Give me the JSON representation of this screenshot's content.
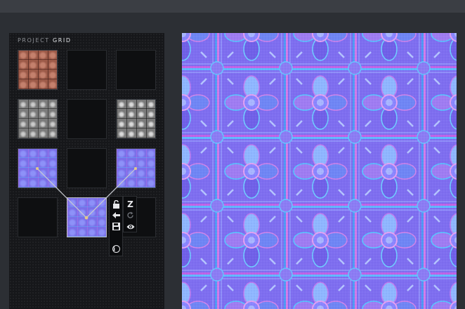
{
  "panel": {
    "title_prefix": "PROJECT",
    "title_highlight": "GRID"
  },
  "grid": {
    "cells": [
      {
        "name": "grid-cell-r1c1",
        "texture": "diffuse",
        "state": "filled"
      },
      {
        "name": "grid-cell-r1c2",
        "texture": "empty",
        "state": "empty"
      },
      {
        "name": "grid-cell-r1c3",
        "texture": "empty",
        "state": "empty"
      },
      {
        "name": "grid-cell-r2c1",
        "texture": "height-map",
        "state": "filled"
      },
      {
        "name": "grid-cell-r2c2",
        "texture": "empty",
        "state": "empty"
      },
      {
        "name": "grid-cell-r2c3",
        "texture": "specular-map",
        "state": "filled"
      },
      {
        "name": "grid-cell-r3c1",
        "texture": "normal-map",
        "state": "filled"
      },
      {
        "name": "grid-cell-r3c2",
        "texture": "empty",
        "state": "empty"
      },
      {
        "name": "grid-cell-r3c3",
        "texture": "normal-map",
        "state": "filled"
      },
      {
        "name": "grid-cell-r4c1",
        "texture": "empty",
        "state": "empty"
      },
      {
        "name": "grid-cell-r4c2",
        "texture": "normal-map",
        "state": "selected"
      },
      {
        "name": "grid-cell-r4c3",
        "texture": "empty",
        "state": "empty"
      }
    ]
  },
  "toolbar": {
    "tools": [
      {
        "name": "lock-icon",
        "glyph": "🔓"
      },
      {
        "name": "arrow-left-icon",
        "glyph": "🡸"
      },
      {
        "name": "save-icon",
        "glyph": "💾"
      },
      {
        "name": "invert-z-icon",
        "glyph": "Z"
      },
      {
        "name": "refresh-icon",
        "glyph": "↻"
      },
      {
        "name": "eye-icon",
        "glyph": "👁"
      },
      {
        "name": "info-icon",
        "glyph": "i"
      }
    ]
  },
  "preview": {
    "texture": "normal-map"
  },
  "colors": {
    "background": "#2c2f34",
    "panel": "#16171a",
    "normal_map_base": "#7e6ef0",
    "link_line": "#c9ccd2"
  }
}
